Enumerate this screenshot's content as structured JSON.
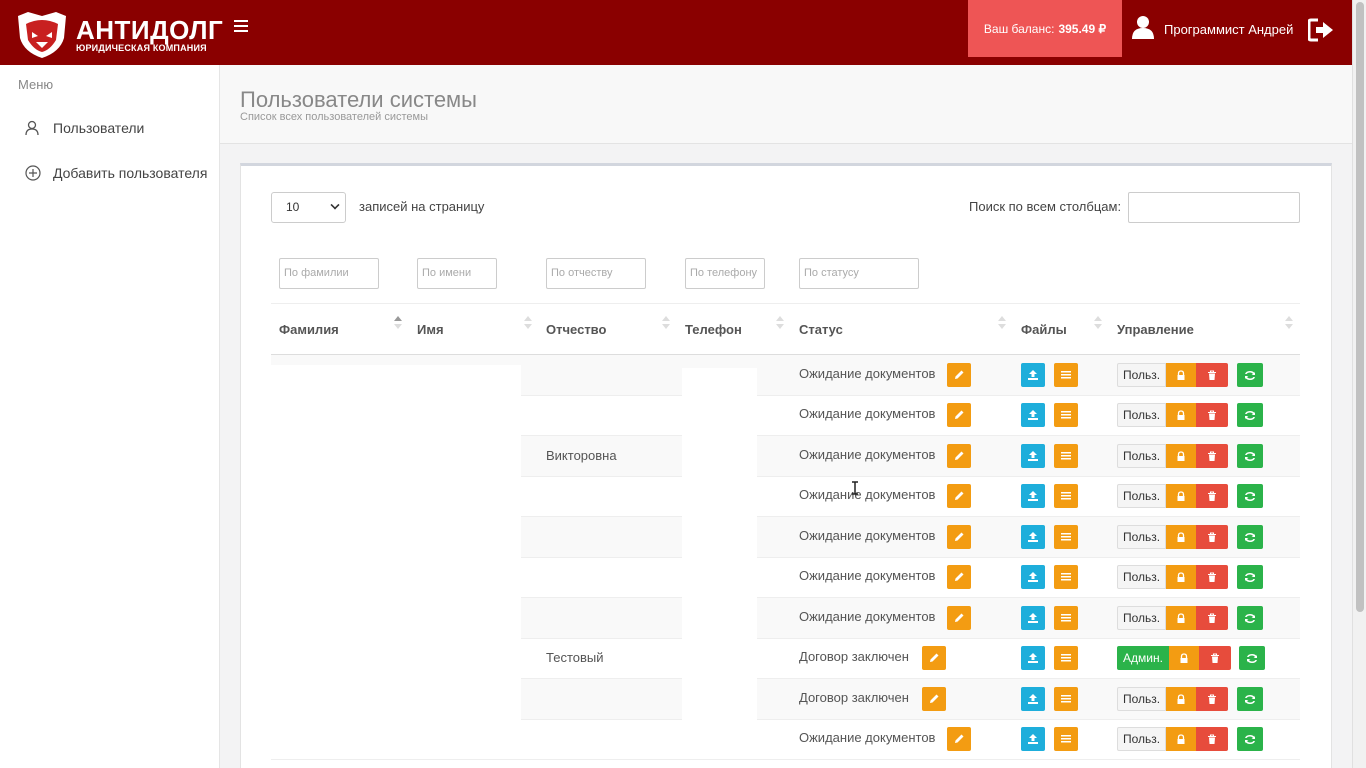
{
  "header": {
    "brand_title": "АНТИДОЛГ",
    "brand_subtitle": "ЮРИДИЧЕСКАЯ КОМПАНИЯ",
    "balance_label": "Ваш баланс:",
    "balance_value": "395.49 ₽",
    "user_name": "Программист Андрей"
  },
  "sidebar": {
    "menu_label": "Меню",
    "items": [
      {
        "label": "Пользователи",
        "icon": "users-icon"
      },
      {
        "label": "Добавить пользователя",
        "icon": "plus-circle-icon"
      }
    ]
  },
  "page": {
    "title": "Пользователи системы",
    "subtitle": "Список всех пользователей системы"
  },
  "table_controls": {
    "page_length": "10",
    "page_length_label": "записей на страницу",
    "search_label": "Поиск по всем столбцам:",
    "search_value": ""
  },
  "filters": {
    "last_name": "По фамилии",
    "first_name": "По имени",
    "patronymic": "По отчеству",
    "phone": "По телефону",
    "status": "По статусу"
  },
  "columns": [
    "Фамилия",
    "Имя",
    "Отчество",
    "Телефон",
    "Статус",
    "Файлы",
    "Управление"
  ],
  "rows": [
    {
      "patronymic": "",
      "status": "Ожидание документов",
      "role": "Польз."
    },
    {
      "patronymic": "",
      "status": "Ожидание документов",
      "role": "Польз."
    },
    {
      "patronymic": "Викторовна",
      "status": "Ожидание документов",
      "role": "Польз."
    },
    {
      "patronymic": "",
      "status": "Ожидание документов",
      "role": "Польз."
    },
    {
      "patronymic": "",
      "status": "Ожидание документов",
      "role": "Польз."
    },
    {
      "patronymic": "",
      "status": "Ожидание документов",
      "role": "Польз."
    },
    {
      "patronymic": "",
      "status": "Ожидание документов",
      "role": "Польз."
    },
    {
      "patronymic": "Тестовый",
      "status": "Договор заключен",
      "role": "Админ."
    },
    {
      "patronymic": "",
      "status": "Договор заключен",
      "role": "Польз."
    },
    {
      "patronymic": "",
      "status": "Ожидание документов",
      "role": "Польз."
    }
  ],
  "colors": {
    "header_bg": "#8a0000",
    "balance_bg": "#ee5555",
    "orange": "#f39c12",
    "blue": "#1eaedb",
    "red": "#e74c3c",
    "green": "#2bb34a"
  }
}
